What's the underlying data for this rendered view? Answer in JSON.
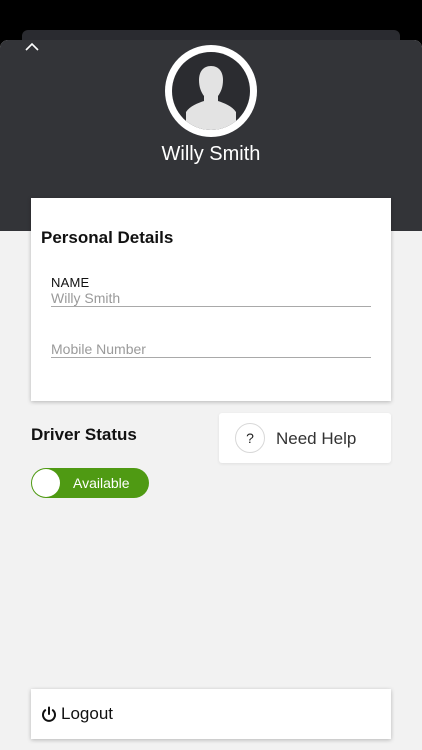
{
  "profile": {
    "name": "Willy Smith"
  },
  "personal_details": {
    "title": "Personal Details",
    "name_label": "NAME",
    "name_value": "Willy Smith",
    "mobile_placeholder": "Mobile Number"
  },
  "driver_status": {
    "title": "Driver Status",
    "toggle_label": "Available",
    "toggle_on": true,
    "toggle_color": "#4f9a13"
  },
  "help": {
    "icon_glyph": "?",
    "label": "Need Help"
  },
  "logout": {
    "label": "Logout"
  },
  "icons": {
    "collapse": "chevron-up-icon",
    "avatar": "user-silhouette-icon",
    "help": "question-mark-icon",
    "logout": "power-icon"
  },
  "colors": {
    "header": "#333438",
    "background": "#f2f2f2",
    "card": "#ffffff"
  }
}
